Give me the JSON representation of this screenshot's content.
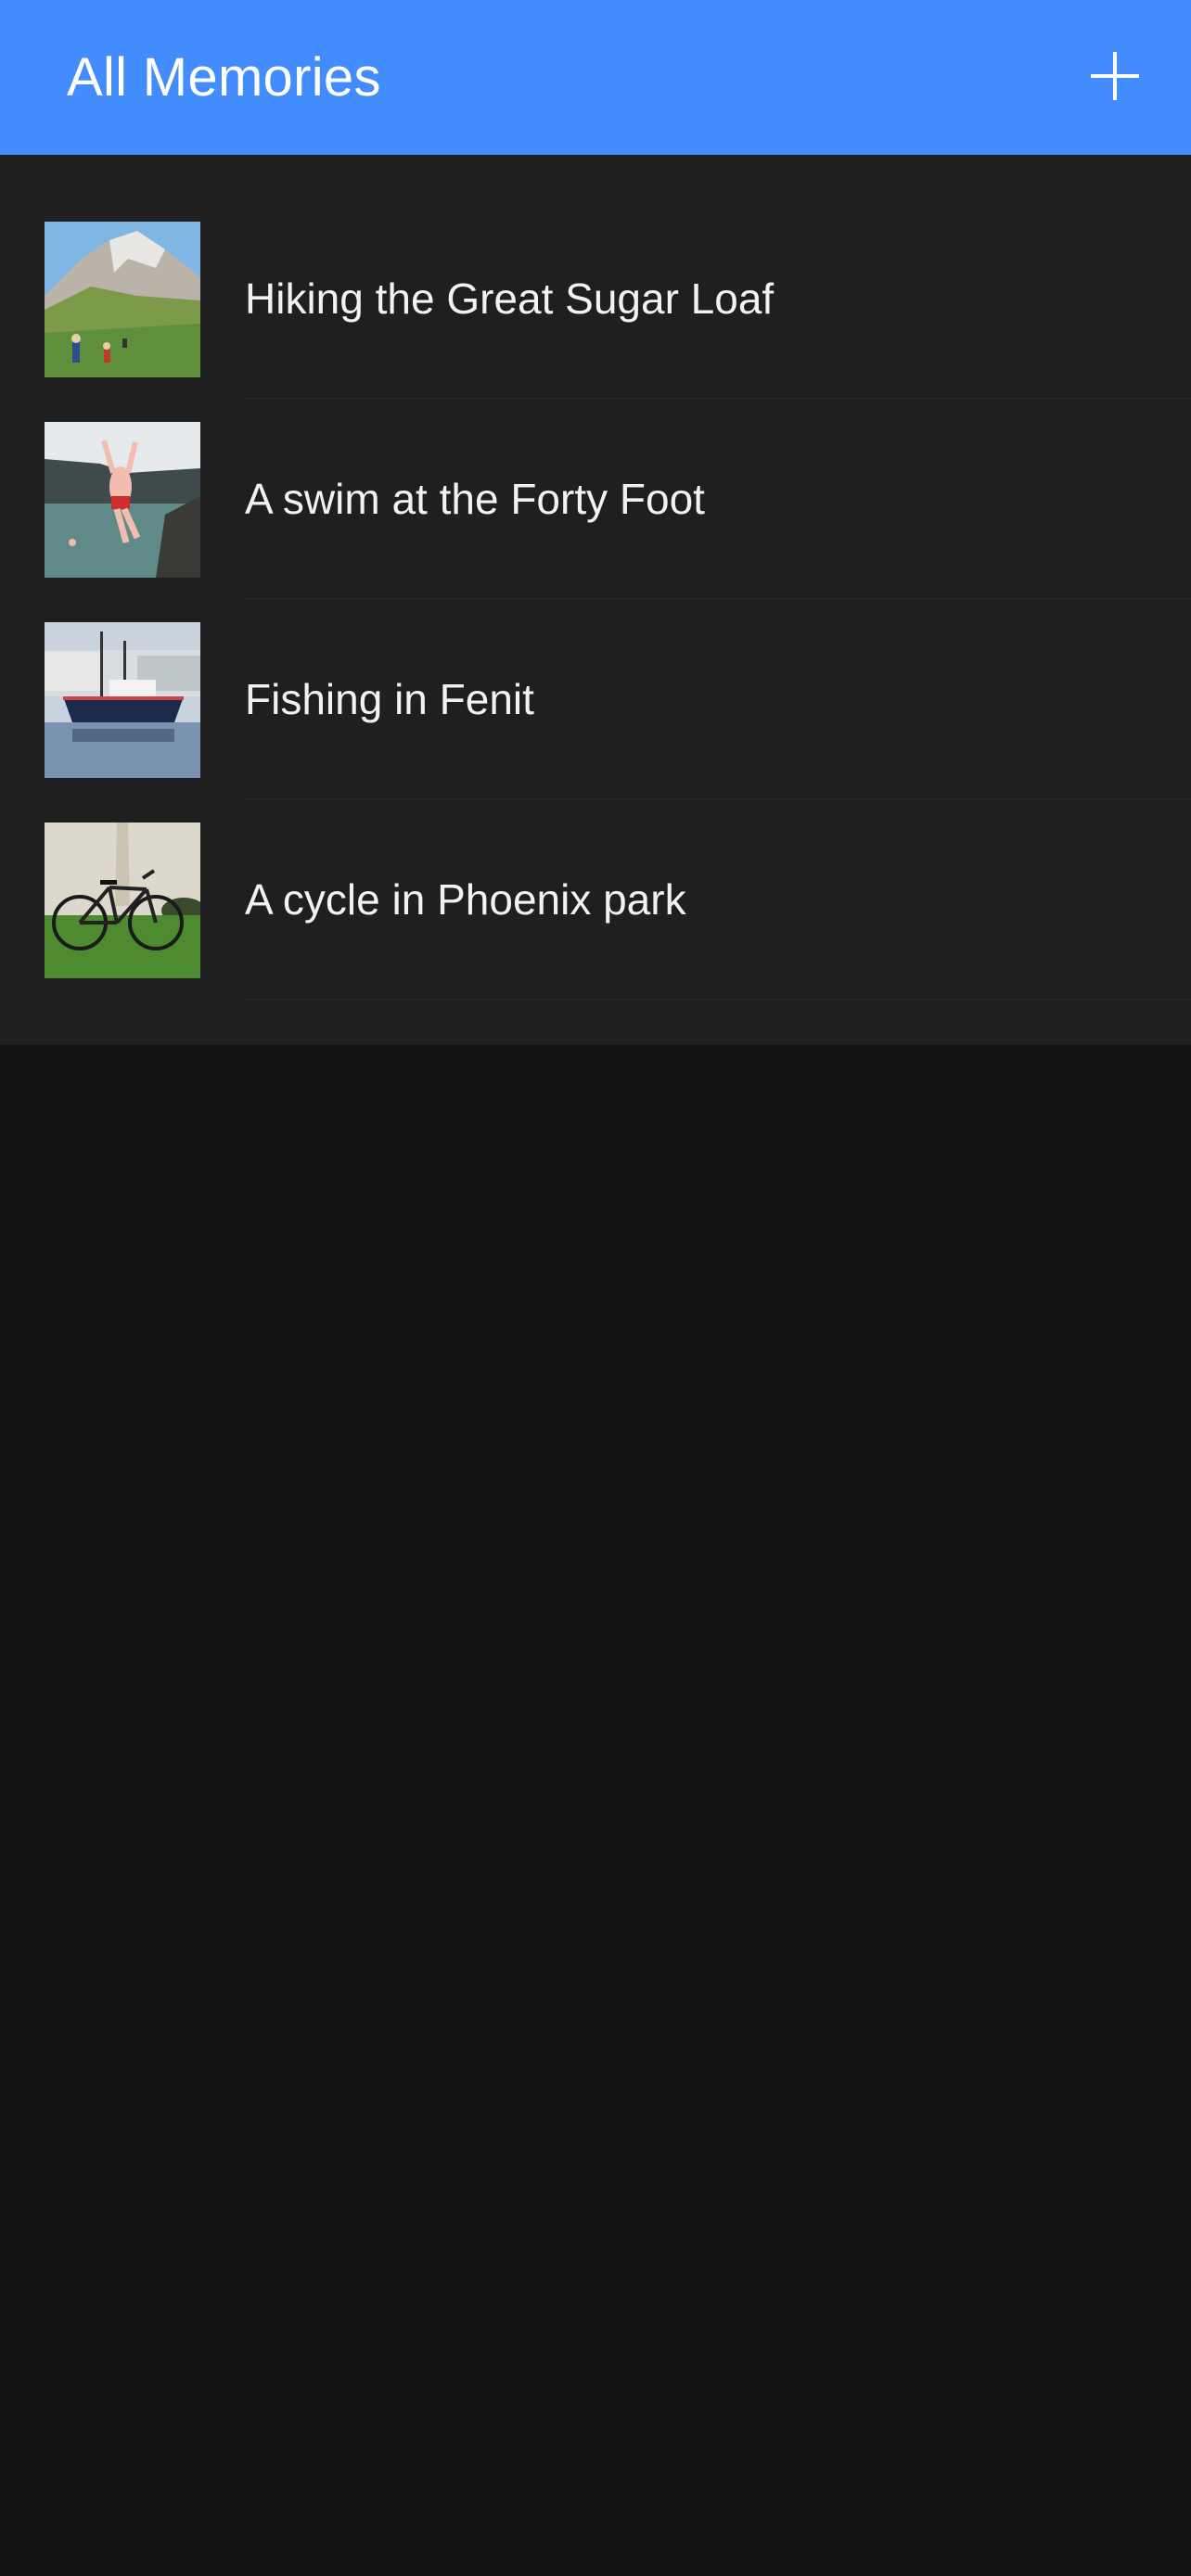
{
  "header": {
    "title": "All Memories",
    "add_icon": "plus-icon",
    "background_color": "#428cfe"
  },
  "memories": [
    {
      "title": "Hiking the Great Sugar Loaf",
      "thumbnail": "mountain-hikers-photo"
    },
    {
      "title": "A swim at the Forty Foot",
      "thumbnail": "swimmer-jumping-photo"
    },
    {
      "title": "Fishing in Fenit",
      "thumbnail": "fishing-boat-harbour-photo"
    },
    {
      "title": "A cycle in Phoenix park",
      "thumbnail": "bicycle-park-photo"
    }
  ],
  "colors": {
    "list_background": "#1f1f1f",
    "page_background": "#121212",
    "text": "#f2f2f2"
  }
}
